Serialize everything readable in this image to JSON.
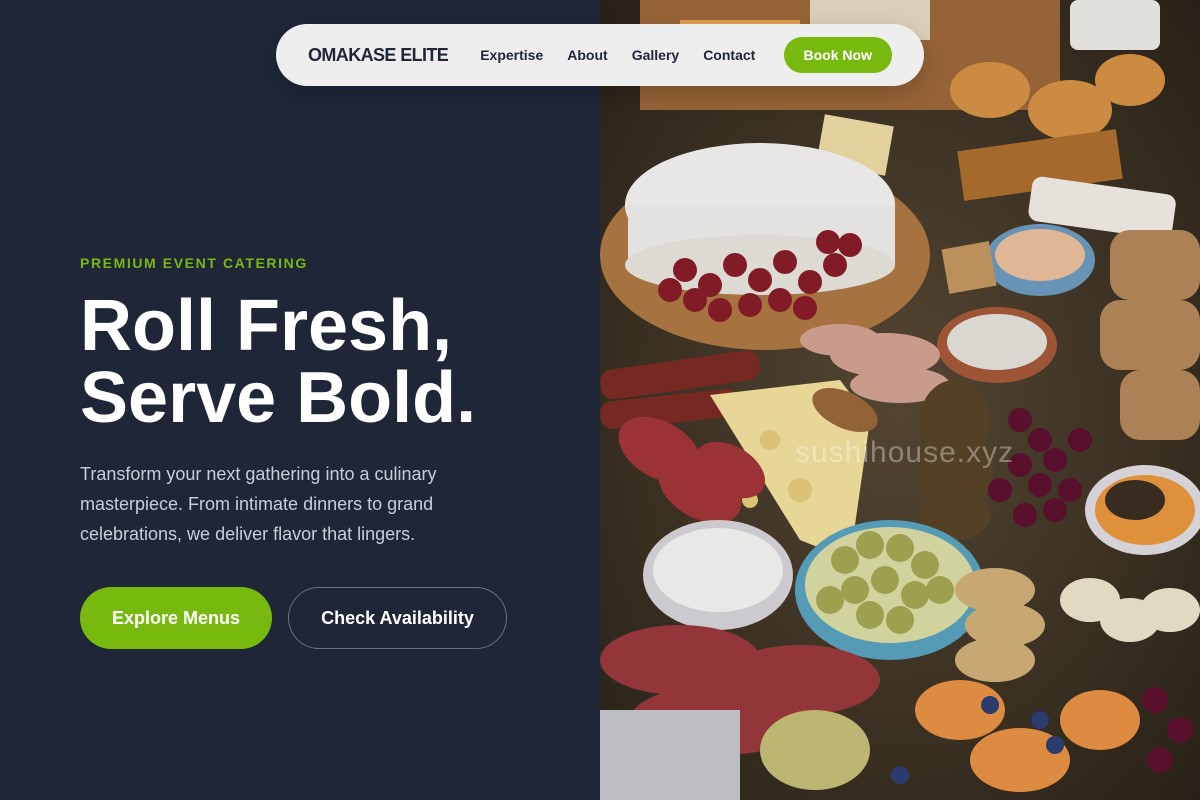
{
  "nav": {
    "brand": "OMAKASE ELITE",
    "links": [
      "Expertise",
      "About",
      "Gallery",
      "Contact"
    ],
    "cta": "Book Now"
  },
  "hero": {
    "eyebrow": "PREMIUM EVENT CATERING",
    "headline_line1": "Roll Fresh,",
    "headline_line2": "Serve Bold.",
    "description": "Transform your next gathering into a culinary masterpiece. From intimate dinners to grand celebrations, we deliver flavor that lingers.",
    "primary_button": "Explore Menus",
    "secondary_button": "Check Availability"
  },
  "image": {
    "subject": "charcuterie grazing table",
    "watermark": "sushihouse.xyz"
  },
  "colors": {
    "background": "#1e2638",
    "accent": "#78b90f",
    "nav_background": "#eeeeef",
    "text_primary": "#ffffff",
    "text_muted": "#c8ced9"
  }
}
